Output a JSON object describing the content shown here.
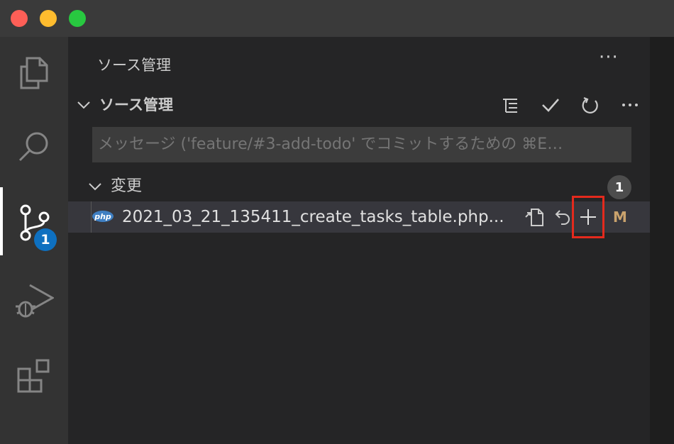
{
  "window": {
    "traffic_lights": [
      "close",
      "minimize",
      "maximize"
    ],
    "colors": {
      "close": "#fe5f57",
      "minimize": "#febc2e",
      "maximize": "#28c840"
    }
  },
  "activity_bar": {
    "items": [
      {
        "name": "explorer",
        "icon": "files-icon"
      },
      {
        "name": "search",
        "icon": "search-icon"
      },
      {
        "name": "source-control",
        "icon": "source-control-icon",
        "active": true,
        "badge": "1"
      },
      {
        "name": "run-and-debug",
        "icon": "debug-icon"
      },
      {
        "name": "extensions",
        "icon": "extensions-icon"
      }
    ],
    "badge_color": "#0e70c0"
  },
  "panel": {
    "title": "ソース管理",
    "more_icon": "ellipsis-icon",
    "more_label": "···"
  },
  "scm_section": {
    "title": "ソース管理",
    "actions": [
      {
        "name": "view-as-tree",
        "icon": "list-tree-icon"
      },
      {
        "name": "commit",
        "icon": "check-icon"
      },
      {
        "name": "refresh",
        "icon": "refresh-icon"
      },
      {
        "name": "more-actions",
        "icon": "ellipsis-icon"
      }
    ]
  },
  "commit_input": {
    "placeholder": "メッセージ ('feature/#3-add-todo' でコミットするための ⌘E…",
    "value": ""
  },
  "changes": {
    "label": "変更",
    "count": "1",
    "files": [
      {
        "name": "2021_03_21_135411_create_tasks_table.php...",
        "icon": "php-file-icon",
        "icon_label": "php",
        "status": "M",
        "status_color": "#c9a26d",
        "actions": [
          {
            "name": "open-file",
            "icon": "go-to-file-icon"
          },
          {
            "name": "discard-changes",
            "icon": "discard-icon"
          },
          {
            "name": "stage-changes",
            "icon": "add-icon",
            "highlighted": true
          }
        ]
      }
    ]
  },
  "highlight_color": "#e42a1d"
}
